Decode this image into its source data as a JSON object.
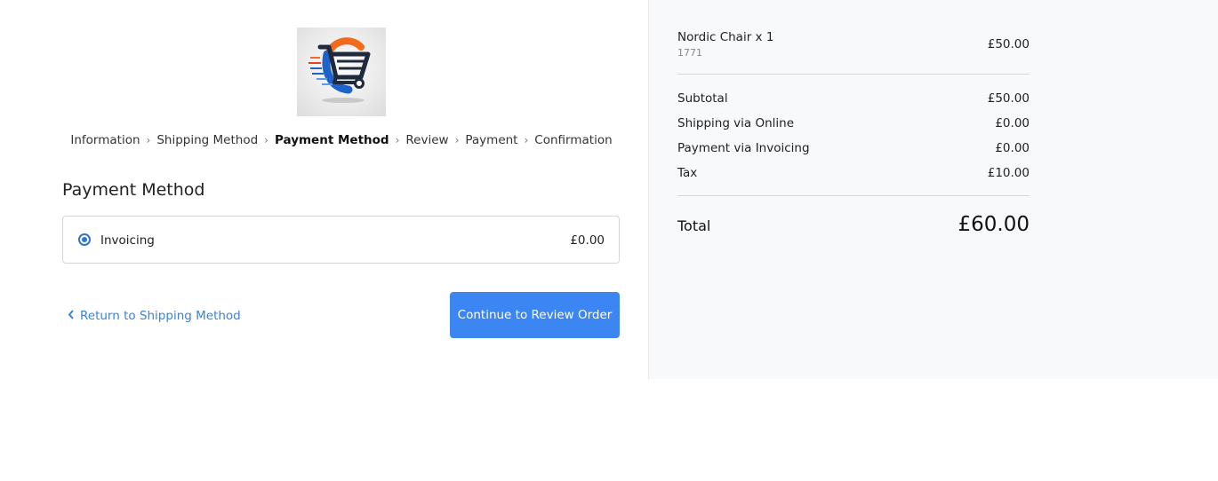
{
  "breadcrumb": [
    {
      "label": "Information"
    },
    {
      "label": "Shipping Method"
    },
    {
      "label": "Payment Method",
      "current": true
    },
    {
      "label": "Review"
    },
    {
      "label": "Payment"
    },
    {
      "label": "Confirmation"
    }
  ],
  "breadcrumb_separator": "›",
  "section_title": "Payment Method",
  "payment_method": {
    "label": "Invoicing",
    "price": "£0.00",
    "selected": true
  },
  "back_link": {
    "label": "Return to Shipping Method",
    "icon": "chevron-left-icon"
  },
  "continue_button": {
    "label": "Continue to Review Order"
  },
  "summary": {
    "item": {
      "name": "Nordic Chair x 1",
      "sku": "1771",
      "price": "£50.00"
    },
    "rows": [
      {
        "label": "Subtotal",
        "value": "£50.00"
      },
      {
        "label": "Shipping via Online",
        "value": "£0.00"
      },
      {
        "label": "Payment via Invoicing",
        "value": "£0.00"
      },
      {
        "label": "Tax",
        "value": "£10.00"
      }
    ],
    "total": {
      "label": "Total",
      "value": "£60.00"
    }
  },
  "colors": {
    "accent": "#3b86f2",
    "link": "#3b82d6",
    "sidebar_bg": "#f8f9fb",
    "logo_orange": "#f26a1b",
    "logo_blue": "#1e63c9",
    "logo_navy": "#1f2a3c"
  },
  "logo_icon": "shopping-cart-logo"
}
